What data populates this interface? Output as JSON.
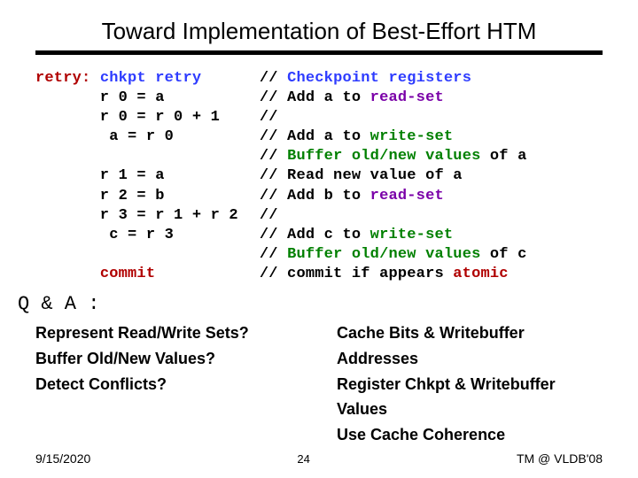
{
  "title": "Toward Implementation of Best-Effort HTM",
  "code_left": [
    {
      "segments": [
        {
          "t": "retry:",
          "c": "kw1"
        },
        {
          "t": " "
        },
        {
          "t": "chkpt retry",
          "c": "kw2"
        }
      ]
    },
    {
      "segments": [
        {
          "t": "       r 0 = a"
        }
      ]
    },
    {
      "segments": [
        {
          "t": "       r 0 = r 0 + 1"
        }
      ]
    },
    {
      "segments": [
        {
          "t": "        a = r 0"
        }
      ]
    },
    {
      "segments": [
        {
          "t": ""
        }
      ]
    },
    {
      "segments": [
        {
          "t": "       r 1 = a"
        }
      ]
    },
    {
      "segments": [
        {
          "t": "       r 2 = b"
        }
      ]
    },
    {
      "segments": [
        {
          "t": "       r 3 = r 1 + r 2"
        }
      ]
    },
    {
      "segments": [
        {
          "t": "        c = r 3"
        }
      ]
    },
    {
      "segments": [
        {
          "t": ""
        }
      ]
    },
    {
      "segments": [
        {
          "t": "       "
        },
        {
          "t": "commit",
          "c": "kw1"
        }
      ]
    }
  ],
  "code_right": [
    {
      "segments": [
        {
          "t": "// "
        },
        {
          "t": "Checkpoint registers",
          "c": "kw2"
        }
      ]
    },
    {
      "segments": [
        {
          "t": "// Add a to "
        },
        {
          "t": "read-set",
          "c": "kw3"
        }
      ]
    },
    {
      "segments": [
        {
          "t": "//"
        }
      ]
    },
    {
      "segments": [
        {
          "t": "// Add a to "
        },
        {
          "t": "write-set",
          "c": "kw4"
        }
      ]
    },
    {
      "segments": [
        {
          "t": "// "
        },
        {
          "t": "Buffer old/new values",
          "c": "kw4"
        },
        {
          "t": " of a"
        }
      ]
    },
    {
      "segments": [
        {
          "t": "// Read new value of a"
        }
      ]
    },
    {
      "segments": [
        {
          "t": "// Add b to "
        },
        {
          "t": "read-set",
          "c": "kw3"
        }
      ]
    },
    {
      "segments": [
        {
          "t": "//"
        }
      ]
    },
    {
      "segments": [
        {
          "t": "// Add c to "
        },
        {
          "t": "write-set",
          "c": "kw4"
        }
      ]
    },
    {
      "segments": [
        {
          "t": "// "
        },
        {
          "t": "Buffer old/new values",
          "c": "kw4"
        },
        {
          "t": " of c"
        }
      ]
    },
    {
      "segments": [
        {
          "t": "// commit if appears "
        },
        {
          "t": "atomic",
          "c": "kw1"
        }
      ]
    }
  ],
  "qa_label": "Q & A :",
  "questions": [
    "Represent Read/Write Sets?",
    "Buffer Old/New Values?",
    "Detect Conflicts?"
  ],
  "answers": [
    "Cache Bits & Writebuffer Addresses",
    "Register Chkpt & Writebuffer Values",
    "Use Cache Coherence"
  ],
  "footer": {
    "date": "9/15/2020",
    "page": "24",
    "venue": "TM @ VLDB'08"
  }
}
